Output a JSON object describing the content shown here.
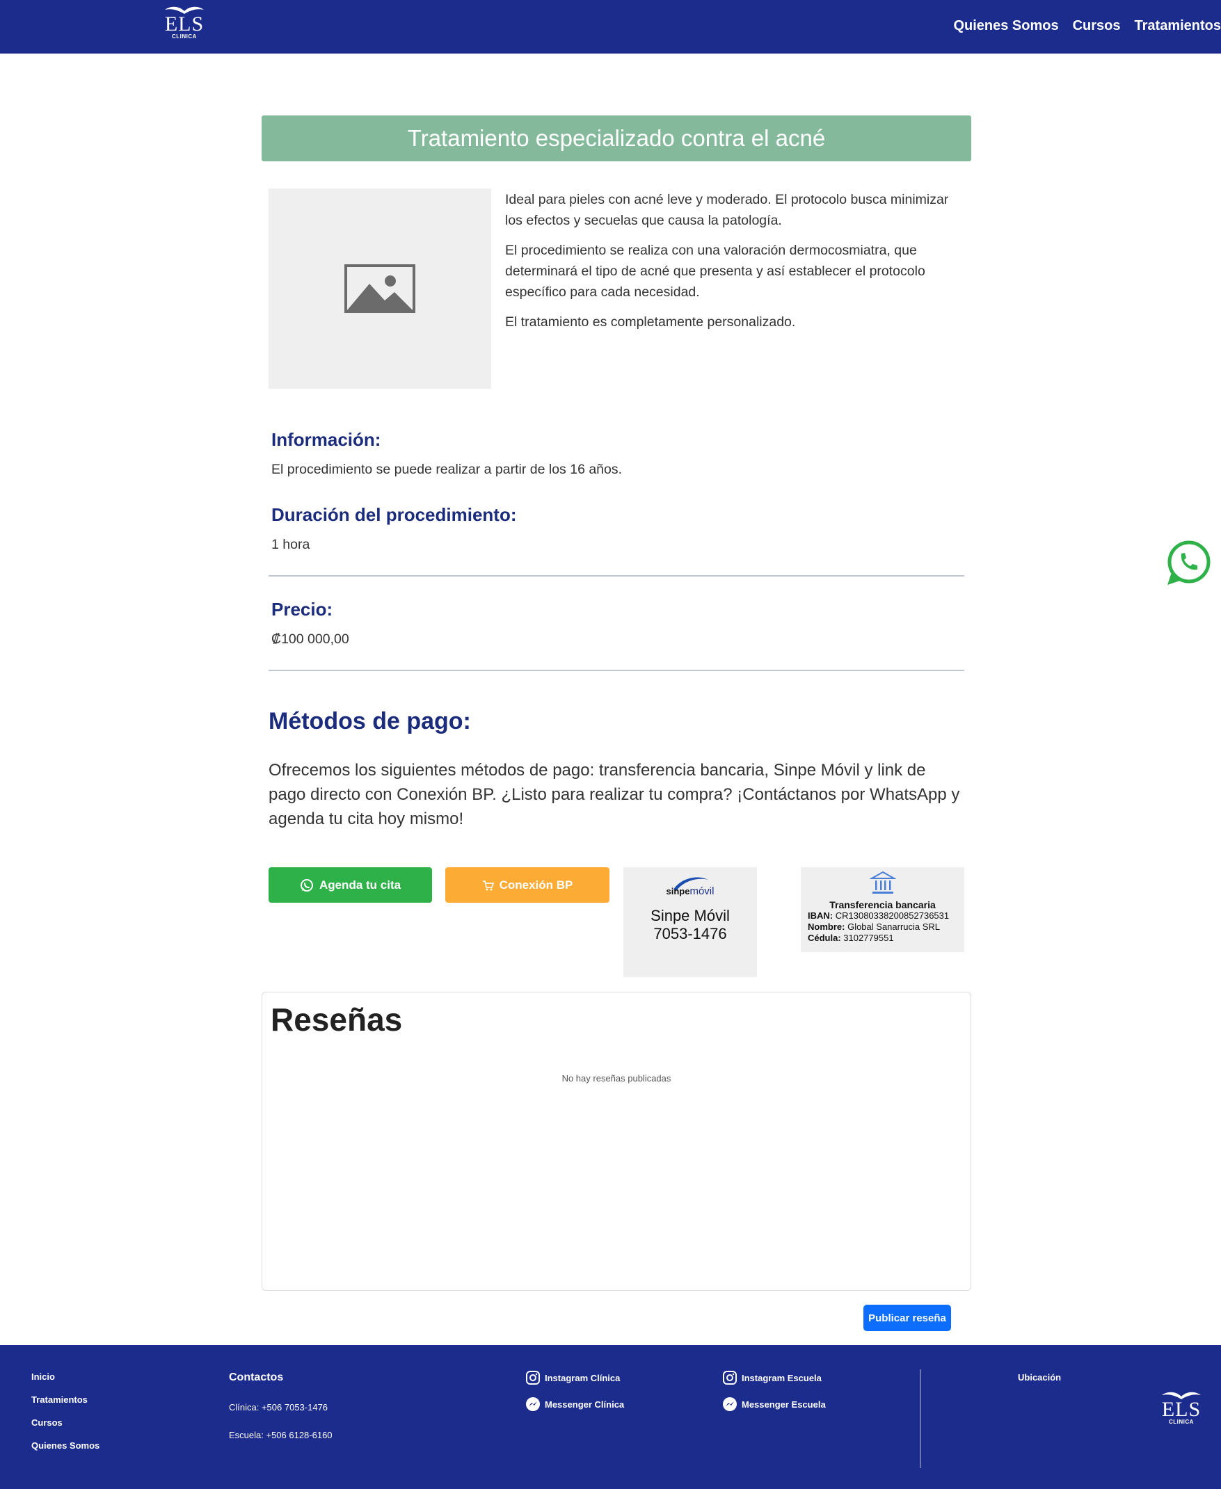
{
  "header": {
    "logo_text": "ELS",
    "logo_sub": "CLINICA",
    "nav": [
      "Quienes Somos",
      "Cursos",
      "Tratamientos"
    ]
  },
  "title": "Tratamiento especializado contra el acné",
  "description": [
    "Ideal para pieles con acné leve y moderado. El protocolo busca minimizar los efectos y secuelas que causa la patología.",
    "El procedimiento se realiza con una valoración dermocosmiatra, que determinará el tipo de acné que presenta y así establecer el protocolo específico para cada necesidad.",
    "El tratamiento es completamente personalizado."
  ],
  "info": {
    "heading": "Información:",
    "text": "El procedimiento se puede realizar a partir de los 16 años."
  },
  "duration": {
    "heading": "Duración del procedimiento:",
    "text": "1 hora"
  },
  "price": {
    "heading": "Precio:",
    "text": "₡100 000,00"
  },
  "payment": {
    "heading": "Métodos de pago:",
    "text": "Ofrecemos los siguientes métodos de pago: transferencia bancaria, Sinpe Móvil y link de pago directo con Conexión BP. ¿Listo para realizar tu compra? ¡Contáctanos por WhatsApp y agenda tu cita hoy mismo!",
    "whatsapp_button": "Agenda tu cita",
    "bp_button": "Conexión BP",
    "sinpe": {
      "brand_bold": "sinpe",
      "brand_rest": "móvil",
      "label": "Sinpe Móvil",
      "number": "7053-1476"
    },
    "bank": {
      "title": "Transferencia bancaria",
      "iban_label": "IBAN:",
      "iban": "CR13080338200852736531",
      "name_label": "Nombre:",
      "name": "Global Sanarrucia SRL",
      "id_label": "Cédula:",
      "id": "3102779551"
    }
  },
  "reviews": {
    "heading": "Reseñas",
    "empty": "No hay reseñas publicadas",
    "publish_button": "Publicar reseña"
  },
  "footer": {
    "links": [
      "Inicio",
      "Tratamientos",
      "Cursos",
      "Quienes Somos"
    ],
    "contacts_heading": "Contactos",
    "contacts": [
      "Clínica: +506 7053-1476",
      "Escuela: +506 6128-6160"
    ],
    "instagram_clinic": "Instagram Clínica",
    "messenger_clinic": "Messenger Clínica",
    "instagram_school": "Instagram Escuela",
    "messenger_school": "Messenger Escuela",
    "location": "Ubicación",
    "logo_text": "ELS",
    "logo_sub": "CLINICA"
  },
  "colors": {
    "brand_blue": "#1c2c8c",
    "banner_green": "#85b99c",
    "whatsapp_green": "#2fb14a",
    "bp_orange": "#fcab34",
    "publish_blue": "#0d6efd"
  },
  "icons": [
    "whatsapp-icon",
    "cart-icon",
    "bank-icon",
    "image-placeholder-icon",
    "instagram-icon",
    "messenger-icon"
  ]
}
